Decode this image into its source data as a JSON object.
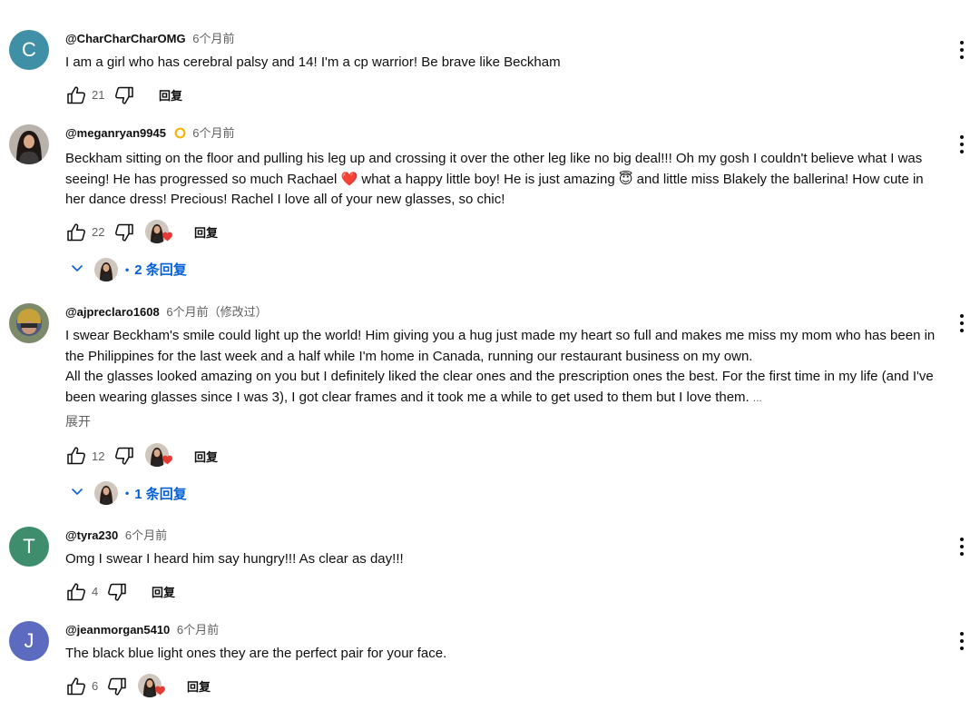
{
  "comments": [
    {
      "avatar_letter": "C",
      "avatar_color": "#3f8fa6",
      "author": "@CharCharCharOMG",
      "time": "6个月前",
      "text": [
        "I am a girl who has cerebral palsy and 14! I'm a cp warrior! Be brave like Beckham"
      ],
      "likes": "21",
      "reply_label": "回复"
    },
    {
      "author": "@meganryan9945",
      "time": "6个月前",
      "text_parts": [
        "Beckham sitting on the floor and pulling his leg up and crossing it over the other leg like no big deal!!! Oh my gosh I couldn't believe what I was seeing! He has progressed so much Rachael ",
        "❤️",
        " what a happy little boy! He is just amazing ",
        "😇",
        " and little miss Blakely the ballerina! How cute in her dance dress! Precious! Rachel I love all of your new glasses, so chic!"
      ],
      "likes": "22",
      "reply_label": "回复",
      "replies_label": "2 条回复"
    },
    {
      "author": "@ajpreclaro1608",
      "time": "6个月前（修改过）",
      "text": [
        "I swear Beckham's smile could light up the world! Him giving you a hug just made my heart so full and makes me miss my mom who has been in the Philippines for the last week and a half while I'm home in Canada, running our restaurant business on my own.",
        "All the glasses looked amazing on you but I definitely liked the clear ones and the prescription ones the best. For the first time in my life (and I've been wearing glasses since I was 3), I got clear frames and it took me a while to get used to them but I love them."
      ],
      "ellipsis": "...",
      "expand_label": "展开",
      "likes": "12",
      "reply_label": "回复",
      "replies_label": "1 条回复"
    },
    {
      "avatar_letter": "T",
      "avatar_color": "#3e8e6e",
      "author": "@tyra230",
      "time": "6个月前",
      "text": [
        "Omg I swear I heard him say hungry!!! As clear as day!!!"
      ],
      "likes": "4",
      "reply_label": "回复"
    },
    {
      "avatar_letter": "J",
      "avatar_color": "#5c6bc0",
      "author": "@jeanmorgan5410",
      "time": "6个月前",
      "text": [
        "The black blue light ones they are the perfect pair for your face."
      ],
      "likes": "6",
      "reply_label": "回复"
    }
  ],
  "colors": {
    "link": "#065fd4",
    "meta": "#606060",
    "verify_badge": "#f4b400",
    "heart": "#e53935"
  },
  "icons": [
    "thumb-up-icon",
    "thumb-down-icon",
    "kebab-menu-icon",
    "chevron-down-icon",
    "heart-icon",
    "verified-badge-icon"
  ]
}
